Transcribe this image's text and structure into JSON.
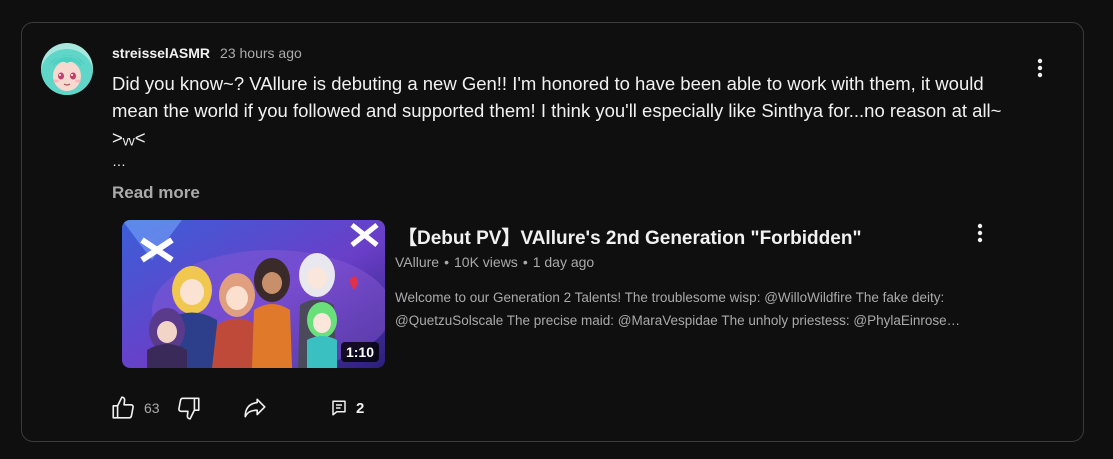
{
  "comment": {
    "author": "streisselASMR",
    "time": "23 hours ago",
    "text": "Did you know~? VAllure is debuting a new Gen!! I'm honored to have been able to work with them, it would mean the world if you followed and supported them! I think you'll especially like Sinthya for...no reason at all~ >ᵥᵥ<",
    "ellipsis": "…",
    "read_more": "Read more",
    "like_count": "63",
    "reply_count": "2"
  },
  "video": {
    "title": "【Debut PV】VAllure's 2nd Generation \"Forbidden\"",
    "channel": "VAllure",
    "views": "10K views",
    "age": "1 day ago",
    "meta_separator": "•",
    "duration": "1:10",
    "description_line1": "Welcome to our Generation 2 Talents! The troublesome wisp: @WilloWildfire The fake deity:",
    "description_line2": "@QuetzuSolscale The precise maid: @MaraVespidae The unholy priestess: @PhylaEinrose…"
  },
  "icons": {
    "like": "thumbs-up-icon",
    "dislike": "thumbs-down-icon",
    "share": "share-icon",
    "reply": "comment-icon",
    "menu": "more-vert-icon"
  },
  "colors": {
    "background": "#0f0f0f",
    "border": "#3a3a3a",
    "text_primary": "#f1f1f1",
    "text_secondary": "#aaaaaa",
    "avatar_hair": "#5fd6c8"
  }
}
